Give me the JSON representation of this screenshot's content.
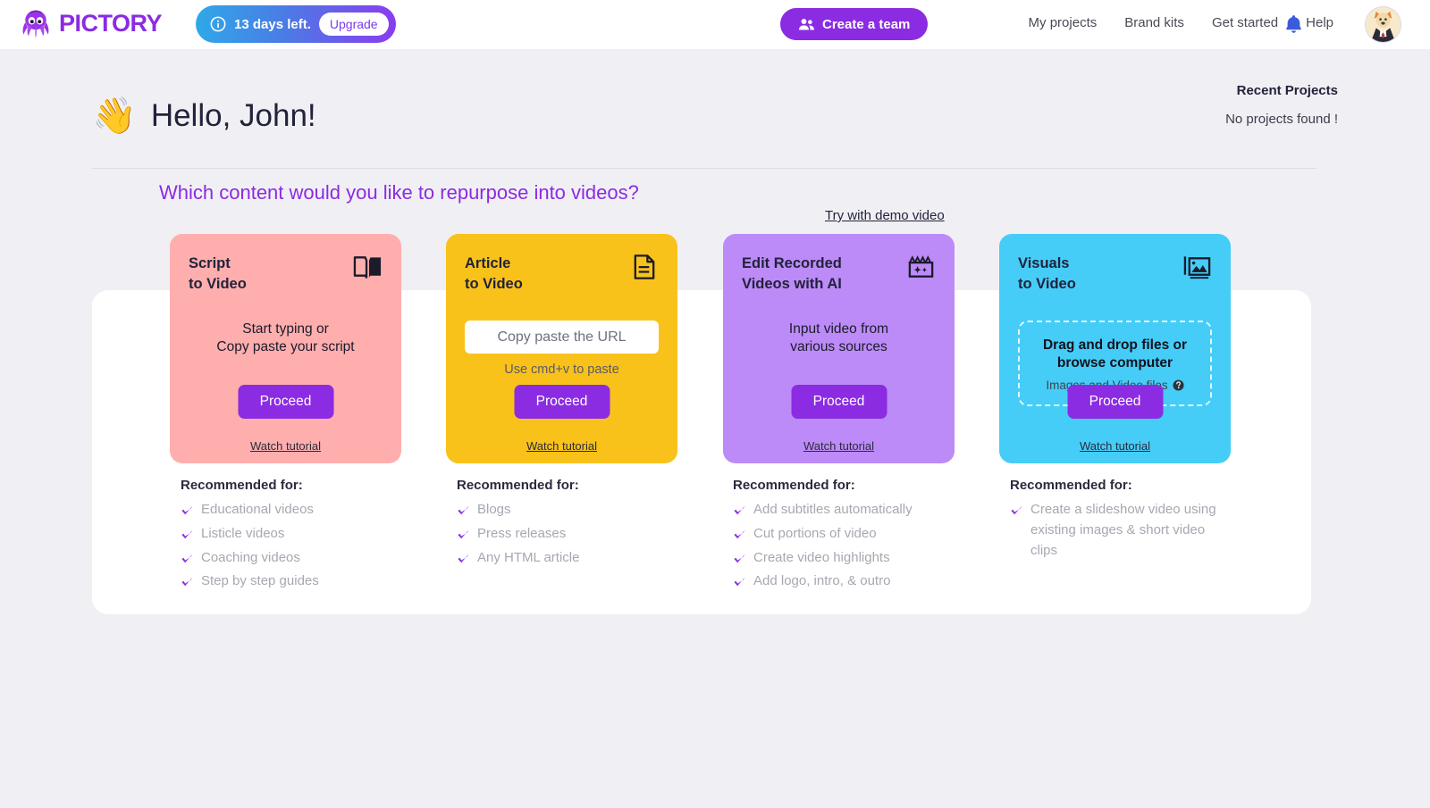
{
  "topbar": {
    "logo_text": "PICTORY",
    "logo_icon": "octopus-icon",
    "trial": {
      "icon": "info-icon",
      "text": "13 days left.",
      "upgrade_label": "Upgrade"
    },
    "create_team": {
      "icon": "people-icon",
      "label": "Create a team"
    },
    "nav_links": [
      "My projects",
      "Brand kits",
      "Get started",
      "Help"
    ],
    "bell_icon": "notification-bell-icon",
    "avatar_icon": "user-avatar"
  },
  "greeting": {
    "wave": "👋",
    "text": "Hello, John!"
  },
  "recent": {
    "title": "Recent Projects",
    "empty": "No projects found !"
  },
  "question": "Which content would you like to repurpose into videos?",
  "demo_link": "Try with demo video",
  "colors": {
    "brand_purple": "#8B2BE2",
    "card_pink": "#FFAEAE",
    "card_yellow": "#F9C21B",
    "card_purple": "#BC8BF7",
    "card_blue": "#45CDF8",
    "bell_blue": "#3B5BDB"
  },
  "cards": [
    {
      "title_line1": "Script",
      "title_line2": "to Video",
      "icon": "open-book-icon",
      "body_line1": "Start typing or",
      "body_line2": "Copy paste your script",
      "proceed_label": "Proceed",
      "watch_label": "Watch tutorial",
      "recommended_title": "Recommended for:",
      "recommended": [
        "Educational videos",
        "Listicle videos",
        "Coaching videos",
        "Step by step guides"
      ]
    },
    {
      "title_line1": "Article",
      "title_line2": "to Video",
      "icon": "document-icon",
      "input_placeholder": "Copy paste the URL",
      "input_value": "",
      "hint": "Use cmd+v to paste",
      "proceed_label": "Proceed",
      "watch_label": "Watch tutorial",
      "recommended_title": "Recommended for:",
      "recommended": [
        "Blogs",
        "Press releases",
        "Any HTML article"
      ]
    },
    {
      "title_line1": "Edit Recorded",
      "title_line2": "Videos with AI",
      "icon": "clapperboard-ai-icon",
      "body_line1": "Input video from",
      "body_line2": "various sources",
      "proceed_label": "Proceed",
      "watch_label": "Watch tutorial",
      "recommended_title": "Recommended for:",
      "recommended": [
        "Add subtitles automatically",
        "Cut portions of video",
        "Create video highlights",
        "Add logo, intro, & outro"
      ]
    },
    {
      "title_line1": "Visuals",
      "title_line2": "to Video",
      "icon": "image-folder-icon",
      "dropzone_line1": "Drag and drop files or",
      "dropzone_line2": "browse computer",
      "dropzone_sub": "Images and Video files",
      "dropzone_help_icon": "question-mark-icon",
      "proceed_label": "Proceed",
      "watch_label": "Watch tutorial",
      "recommended_title": "Recommended for:",
      "recommended": [
        "Create a slideshow video using existing images & short video clips"
      ]
    }
  ]
}
